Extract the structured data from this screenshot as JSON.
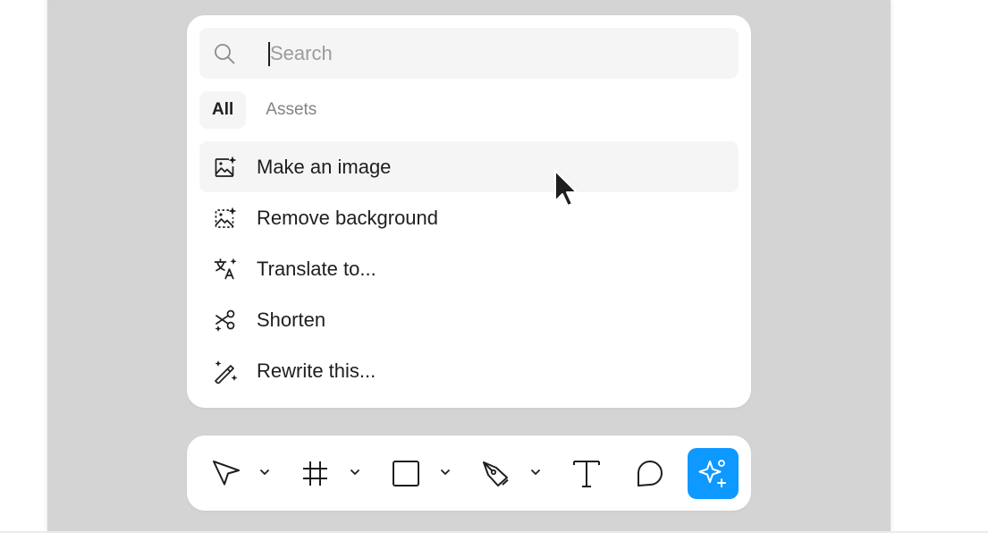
{
  "search": {
    "placeholder": "Search",
    "value": "",
    "icon": "search-icon"
  },
  "tabs": [
    {
      "label": "All",
      "active": true
    },
    {
      "label": "Assets",
      "active": false
    }
  ],
  "menu": {
    "items": [
      {
        "label": "Make an image",
        "icon": "image-sparkle-icon",
        "hovered": true
      },
      {
        "label": "Remove background",
        "icon": "remove-background-icon",
        "hovered": false
      },
      {
        "label": "Translate to...",
        "icon": "translate-icon",
        "hovered": false
      },
      {
        "label": "Shorten",
        "icon": "shorten-icon",
        "hovered": false
      },
      {
        "label": "Rewrite this...",
        "icon": "magic-wand-icon",
        "hovered": false
      }
    ]
  },
  "toolbar": {
    "tools": [
      {
        "name": "move",
        "icon": "move-cursor-icon",
        "has_dropdown": true
      },
      {
        "name": "frame",
        "icon": "frame-icon",
        "has_dropdown": true
      },
      {
        "name": "rectangle",
        "icon": "rectangle-icon",
        "has_dropdown": true
      },
      {
        "name": "pen",
        "icon": "pen-icon",
        "has_dropdown": true
      },
      {
        "name": "text",
        "icon": "text-icon",
        "has_dropdown": false
      },
      {
        "name": "comment",
        "icon": "comment-icon",
        "has_dropdown": false
      },
      {
        "name": "actions",
        "icon": "ai-sparkle-icon",
        "has_dropdown": false,
        "active": true
      }
    ]
  },
  "colors": {
    "canvas": "#d4d4d4",
    "panel": "#ffffff",
    "hover": "#f5f5f5",
    "text": "#1e1e1e",
    "muted": "#828282",
    "accent": "#0d99ff"
  }
}
